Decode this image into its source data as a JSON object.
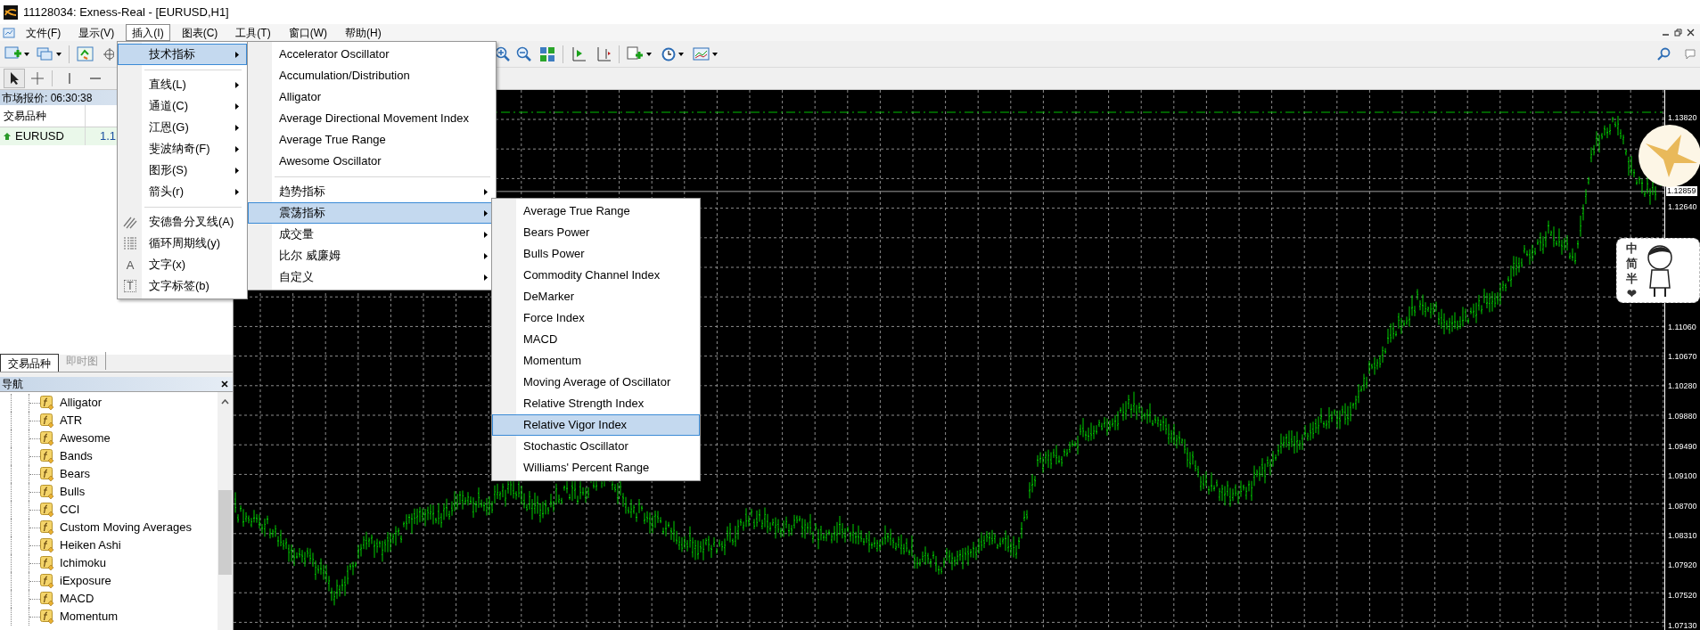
{
  "window": {
    "title": "11128034: Exness-Real - [EURUSD,H1]"
  },
  "menu_bar": [
    {
      "label": "文件(F)",
      "selected": false
    },
    {
      "label": "显示(V)",
      "selected": false
    },
    {
      "label": "插入(I)",
      "selected": true
    },
    {
      "label": "图表(C)",
      "selected": false
    },
    {
      "label": "工具(T)",
      "selected": false
    },
    {
      "label": "窗口(W)",
      "selected": false
    },
    {
      "label": "帮助(H)",
      "selected": false
    }
  ],
  "market_watch": {
    "title": "市场报价: 06:30:38",
    "columns": [
      "交易品种"
    ],
    "rows": [
      {
        "symbol": "EURUSD",
        "bid": "1.1"
      }
    ]
  },
  "panel_tabs": [
    {
      "label": "交易品种",
      "selected": true
    },
    {
      "label": "即时图",
      "selected": false
    }
  ],
  "navigator": {
    "title": "导航",
    "items": [
      "Alligator",
      "ATR",
      "Awesome",
      "Bands",
      "Bears",
      "Bulls",
      "CCI",
      "Custom Moving Averages",
      "Heiken Ashi",
      "Ichimoku",
      "iExposure",
      "MACD",
      "Momentum"
    ]
  },
  "insert_menu": {
    "items": [
      {
        "kind": "submenu",
        "label": "技术指标",
        "selected": true
      },
      {
        "kind": "separator"
      },
      {
        "kind": "submenu",
        "label": "直线(L)",
        "selected": false
      },
      {
        "kind": "submenu",
        "label": "通道(C)",
        "selected": false
      },
      {
        "kind": "submenu",
        "label": "江恩(G)",
        "selected": false
      },
      {
        "kind": "submenu",
        "label": "斐波纳奇(F)",
        "selected": false
      },
      {
        "kind": "submenu",
        "label": "图形(S)",
        "selected": false
      },
      {
        "kind": "submenu",
        "label": "箭头(r)",
        "selected": false
      },
      {
        "kind": "separator"
      },
      {
        "kind": "fork",
        "label": "安德鲁分叉线(A)",
        "selected": false
      },
      {
        "kind": "cycles",
        "label": "循环周期线(y)",
        "selected": false
      },
      {
        "kind": "text",
        "glyph": "A",
        "label": "文字(x)",
        "selected": false
      },
      {
        "kind": "label",
        "glyph": "T",
        "label": "文字标签(b)",
        "selected": false
      }
    ]
  },
  "indicators_menu": {
    "items": [
      {
        "kind": "item",
        "label": "Accelerator Oscillator",
        "selected": false
      },
      {
        "kind": "item",
        "label": "Accumulation/Distribution",
        "selected": false
      },
      {
        "kind": "item",
        "label": "Alligator",
        "selected": false
      },
      {
        "kind": "item",
        "label": "Average Directional Movement Index",
        "selected": false
      },
      {
        "kind": "item",
        "label": "Average True Range",
        "selected": false
      },
      {
        "kind": "item",
        "label": "Awesome Oscillator",
        "selected": false
      },
      {
        "kind": "separator"
      },
      {
        "kind": "submenu",
        "label": "趋势指标",
        "selected": false
      },
      {
        "kind": "submenu",
        "label": "震荡指标",
        "selected": true
      },
      {
        "kind": "submenu",
        "label": "成交量",
        "selected": false
      },
      {
        "kind": "submenu",
        "label": "比尔 威廉姆",
        "selected": false
      },
      {
        "kind": "submenu",
        "label": "自定义",
        "selected": false
      }
    ]
  },
  "oscillators_menu": {
    "items": [
      {
        "label": "Average True Range",
        "selected": false
      },
      {
        "label": "Bears Power",
        "selected": false
      },
      {
        "label": "Bulls Power",
        "selected": false
      },
      {
        "label": "Commodity Channel Index",
        "selected": false
      },
      {
        "label": "DeMarker",
        "selected": false
      },
      {
        "label": "Force Index",
        "selected": false
      },
      {
        "label": "MACD",
        "selected": false
      },
      {
        "label": "Momentum",
        "selected": false
      },
      {
        "label": "Moving Average of Oscillator",
        "selected": false
      },
      {
        "label": "Relative Strength Index",
        "selected": false
      },
      {
        "label": "Relative Vigor Index",
        "selected": true
      },
      {
        "label": "Stochastic Oscillator",
        "selected": false
      },
      {
        "label": "Williams' Percent Range",
        "selected": false
      }
    ]
  },
  "chart": {
    "price_labels": [
      "1.13820",
      "1.12640",
      "1.11060",
      "1.10670",
      "1.10280",
      "1.09880",
      "1.09490",
      "1.09100",
      "1.08700",
      "1.08310",
      "1.07920",
      "1.07520",
      "1.07130"
    ],
    "current_price": "1.12859"
  },
  "ime_toolbar": {
    "items": [
      "中",
      "简",
      "半",
      "❤"
    ]
  }
}
